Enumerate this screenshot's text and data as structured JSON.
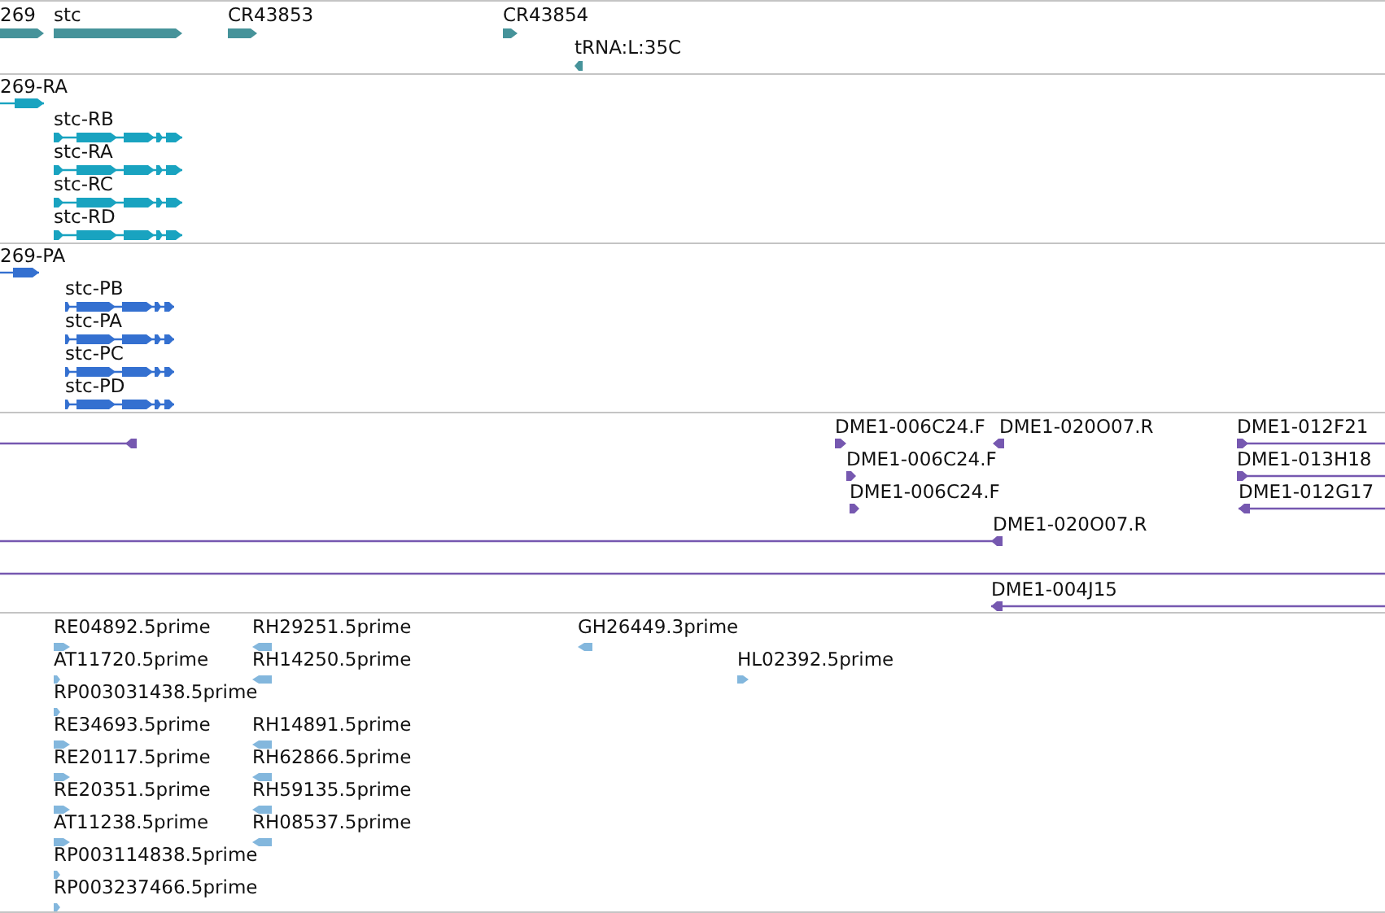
{
  "tracks": [
    {
      "kind": "gene",
      "features": [
        {
          "label": "269",
          "reverse": false
        },
        {
          "label": "stc",
          "reverse": false
        },
        {
          "label": "CR43853",
          "reverse": false
        },
        {
          "label": "CR43854",
          "reverse": false
        },
        {
          "label": "tRNA:L:35C",
          "reverse": true
        }
      ]
    },
    {
      "kind": "transcript",
      "features": [
        {
          "label": "269-RA",
          "reverse": false
        },
        {
          "label": "stc-RB",
          "reverse": false
        },
        {
          "label": "stc-RA",
          "reverse": false
        },
        {
          "label": "stc-RC",
          "reverse": false
        },
        {
          "label": "stc-RD",
          "reverse": false
        }
      ]
    },
    {
      "kind": "transcript",
      "features": [
        {
          "label": "269-PA",
          "reverse": false
        },
        {
          "label": "stc-PB",
          "reverse": false
        },
        {
          "label": "stc-PA",
          "reverse": false
        },
        {
          "label": "stc-PC",
          "reverse": false
        },
        {
          "label": "stc-PD",
          "reverse": false
        }
      ]
    },
    {
      "features": [
        {
          "kind": "clone",
          "reverse": true
        },
        {
          "kind": "clone",
          "label": "DME1-006C24.F",
          "reverse": false
        },
        {
          "kind": "clone",
          "label": "DME1-020O07.R",
          "reverse": true
        },
        {
          "kind": "clone",
          "label": "DME1-012F21",
          "reverse": false
        },
        {
          "kind": "clone",
          "label": "DME1-006C24.F",
          "reverse": false
        },
        {
          "kind": "clone",
          "label": "DME1-013H18",
          "reverse": false
        },
        {
          "kind": "clone",
          "label": "DME1-006C24.F",
          "reverse": false
        },
        {
          "kind": "clone",
          "label": "DME1-012G17",
          "reverse": true
        },
        {
          "kind": "clone",
          "label": "DME1-020O07.R",
          "reverse": true
        },
        {
          "kind": "line"
        },
        {
          "kind": "clone",
          "label": "DME1-004J15",
          "reverse": true
        }
      ]
    },
    {
      "kind": "est",
      "features": [
        {
          "label": "RE04892.5prime",
          "reverse": false
        },
        {
          "label": "RH29251.5prime",
          "reverse": true
        },
        {
          "label": "GH26449.3prime",
          "reverse": true
        },
        {
          "label": "AT11720.5prime",
          "reverse": false
        },
        {
          "label": "RH14250.5prime",
          "reverse": true
        },
        {
          "label": "HL02392.5prime",
          "reverse": false
        },
        {
          "label": "RP003031438.5prime",
          "reverse": false
        },
        {
          "label": "RE34693.5prime",
          "reverse": false
        },
        {
          "label": "RH14891.5prime",
          "reverse": true
        },
        {
          "label": "RE20117.5prime",
          "reverse": false
        },
        {
          "label": "RH62866.5prime",
          "reverse": true
        },
        {
          "label": "RE20351.5prime",
          "reverse": false
        },
        {
          "label": "RH59135.5prime",
          "reverse": true
        },
        {
          "label": "AT11238.5prime",
          "reverse": false
        },
        {
          "label": "RH08537.5prime",
          "reverse": true
        },
        {
          "label": "RP003114838.5prime",
          "reverse": false
        },
        {
          "label": "RP003237466.5prime",
          "reverse": false
        }
      ]
    }
  ]
}
